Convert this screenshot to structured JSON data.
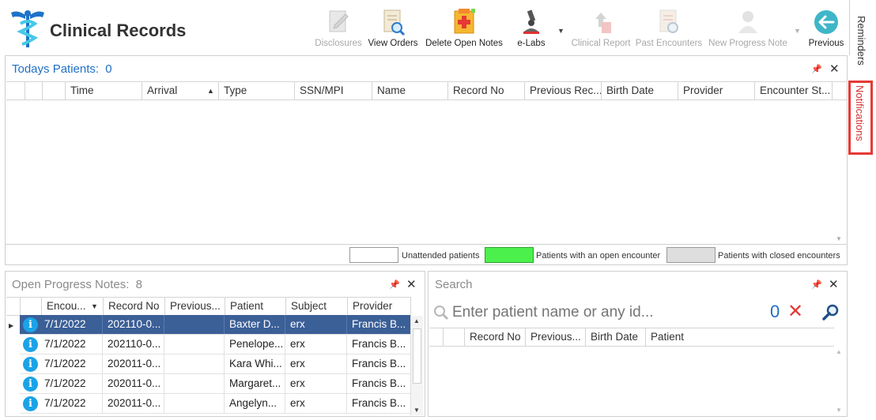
{
  "app": {
    "title": "Clinical Records"
  },
  "toolbar": {
    "disclosures": "Disclosures",
    "view_orders": "View Orders",
    "delete_open_notes": "Delete Open Notes",
    "elabs": "e-Labs",
    "clinical_report": "Clinical Report",
    "past_encounters": "Past Encounters",
    "new_progress_note": "New Progress Note",
    "previous": "Previous"
  },
  "side_tabs": {
    "reminders": "Reminders",
    "notifications": "Notifications"
  },
  "todays_patients": {
    "title": "Todays Patients:",
    "count": "0",
    "columns": [
      "Time",
      "Arrival",
      "Type",
      "SSN/MPI",
      "Name",
      "Record No",
      "Previous Rec...",
      "Birth Date",
      "Provider",
      "Encounter St..."
    ]
  },
  "legend": {
    "unattended": "Unattended patients",
    "open": "Patients with an open encounter",
    "closed": "Patients with closed encounters",
    "colors": {
      "unattended": "#ffffff",
      "open": "#4cf04c",
      "closed": "#dedede"
    }
  },
  "open_notes": {
    "title": "Open Progress Notes:",
    "count": "8",
    "columns": [
      "Encou...",
      "Record No",
      "Previous...",
      "Patient",
      "Subject",
      "Provider"
    ],
    "rows": [
      {
        "date": "7/1/2022",
        "record": "202110-0...",
        "previous": "",
        "patient": "Baxter D...",
        "subject": "erx",
        "provider": "Francis B..."
      },
      {
        "date": "7/1/2022",
        "record": "202110-0...",
        "previous": "",
        "patient": "Penelope...",
        "subject": "erx",
        "provider": "Francis B..."
      },
      {
        "date": "7/1/2022",
        "record": "202011-0...",
        "previous": "",
        "patient": "Kara Whi...",
        "subject": "erx",
        "provider": "Francis B..."
      },
      {
        "date": "7/1/2022",
        "record": "202011-0...",
        "previous": "",
        "patient": "Margaret...",
        "subject": "erx",
        "provider": "Francis B..."
      },
      {
        "date": "7/1/2022",
        "record": "202011-0...",
        "previous": "",
        "patient": "Angelyn...",
        "subject": "erx",
        "provider": "Francis B..."
      }
    ]
  },
  "search": {
    "title": "Search",
    "placeholder": "Enter patient name or any id...",
    "count": "0",
    "columns": [
      "Record No",
      "Previous...",
      "Birth Date",
      "Patient"
    ]
  },
  "colors": {
    "selected_row": "#3b5f97",
    "accent_blue": "#1f6fc5",
    "alert_red": "#e53935"
  }
}
